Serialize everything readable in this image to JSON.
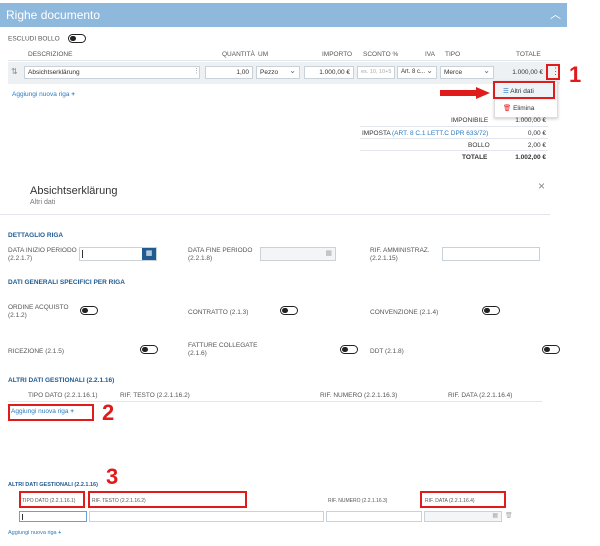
{
  "section1": {
    "title": "Righe documento",
    "escludi_bollo": "ESCLUDI BOLLO",
    "headers": {
      "descrizione": "DESCRIZIONE",
      "quantita": "QUANTITÀ",
      "um": "UM",
      "importo": "IMPORTO",
      "sconto": "SCONTO %",
      "iva": "IVA",
      "tipo": "TIPO",
      "totale": "TOTALE"
    },
    "row": {
      "descrizione": "Absichtserklärung",
      "quantita": "1,00",
      "um": "Pezzo",
      "importo": "1.000,00 €",
      "sconto": "es. 10, 10+5",
      "iva": "Art. 8 c...",
      "tipo": "Merce",
      "totale": "1.000,00 €"
    },
    "add_row": "Aggiungi nuova riga",
    "menu": {
      "altri_dati": "Altri dati",
      "elimina": "Elimina"
    },
    "summary": {
      "imponibile_label": "IMPONIBILE",
      "imponibile_value": "1.000,00 €",
      "imposta_label": "IMPOSTA",
      "imposta_link": "(ART. 8 C.1 LETT.C DPR 633/72)",
      "imposta_value": "0,00 €",
      "bollo_label": "BOLLO",
      "bollo_value": "2,00 €",
      "totale_label": "TOTALE",
      "totale_value": "1.002,00 €"
    }
  },
  "dialog": {
    "title": "Absichtserklärung",
    "subtitle": "Altri dati",
    "close_icon": "×",
    "dettaglio_riga": "DETTAGLIO RIGA",
    "data_inizio_periodo": "DATA INIZIO PERIODO",
    "data_inizio_code": "(2.2.1.7)",
    "data_fine_periodo": "DATA FINE PERIODO",
    "data_fine_code": "(2.2.1.8)",
    "rif_amministraz": "RIF. AMMINISTRAZ.",
    "rif_amministraz_code": "(2.2.1.15)",
    "dati_generali": "DATI GENERALI SPECIFICI PER RIGA",
    "ordine_acquisto": "ORDINE ACQUISTO",
    "ordine_acquisto_code": "(2.1.2)",
    "contratto": "CONTRATTO (2.1.3)",
    "convenzione": "CONVENZIONE (2.1.4)",
    "ricezione": "RICEZIONE (2.1.5)",
    "fatture_collegate": "FATTURE COLLEGATE",
    "fatture_collegate_code": "(2.1.6)",
    "ddt": "DDT (2.1.8)",
    "altri_dati_gestionali": "ALTRI DATI GESTIONALI (2.2.1.16)",
    "cols": {
      "tipo_dato": "TIPO DATO (2.2.1.16.1)",
      "rif_testo": "RIF. TESTO (2.2.1.16.2)",
      "rif_numero": "RIF. NUMERO (2.2.1.16.3)",
      "rif_data": "RIF. DATA (2.2.1.16.4)"
    },
    "add_row": "Aggiungi nuova riga"
  },
  "section3": {
    "title": "ALTRI DATI GESTIONALI (2.2.1.16)",
    "cols": {
      "tipo_dato": "TIPO DATO (2.2.1.16.1)",
      "rif_testo": "RIF. TESTO (2.2.1.16.2)",
      "rif_numero": "RIF. NUMERO (2.2.1.16.3)",
      "rif_data": "RIF. DATA (2.2.1.16.4)"
    },
    "add_row": "Aggiungi nuova riga"
  },
  "markers": {
    "one": "1",
    "two": "2",
    "three": "3"
  },
  "icons": [
    "chevron-up-icon",
    "drag-handle-icon",
    "plus-icon",
    "kebab-menu-icon",
    "list-icon",
    "trash-icon",
    "calendar-icon",
    "close-icon",
    "chevron-down-icon"
  ],
  "colors": {
    "header_bg": "#8fb8dd",
    "accent_blue": "#1f5a91",
    "annotation_red": "#e01b1b"
  }
}
